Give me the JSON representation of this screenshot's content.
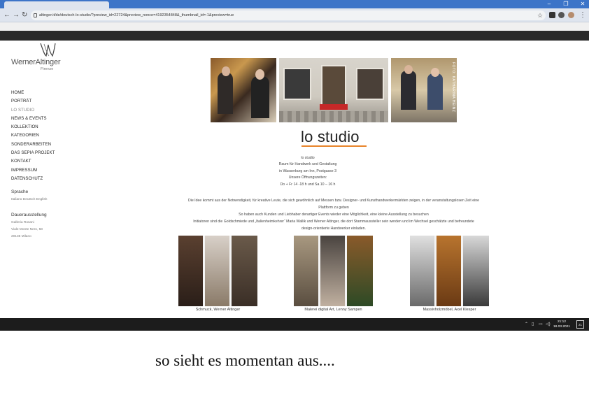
{
  "browser": {
    "url": "altinger.it/de/deutsch-lo-studio/?preview_id=22724&preview_nonce=4192354848&_thumbnail_id=-1&preview=true",
    "win_buttons": [
      "–",
      "❐",
      "✕"
    ]
  },
  "sidebar": {
    "logo_text": "WernerAltinger",
    "logo_sub": "Firenze",
    "nav": [
      "HOME",
      "PORTRÄT",
      "LO STUDIO",
      "NEWS & EVENTS",
      "KOLLEKTION",
      "KATEGORIEN",
      "SONDERARBEITEN",
      "DAS SEPIA PROJEKT",
      "KONTAKT",
      "IMPRESSUM",
      "DATENSCHUTZ"
    ],
    "lang_heading": "Sprache",
    "lang_items": "Italiano Deutsch English",
    "perm_heading": "Dauerausstellung",
    "perm_lines": [
      "Galleria Rosani",
      "Viale Monte Nero, 58",
      "20135 Milano"
    ]
  },
  "main": {
    "photo_credit": "FOTO: KATHARINA HEINZ",
    "title": "lo studio",
    "info_lines": [
      "lo studio",
      "Raum für Handwerk und Gestaltung",
      "in Wasserburg am Inn, Postgasse 3",
      "Unsere Öffnungszeiten:",
      "Do + Fr 14 -18 h und Sa 10 – 16 h"
    ],
    "desc_lines": [
      "Die Idee kommt aus der Notwendigkeit, für kreative Leute, die sich gewöhnlich auf Messen bzw. Designer- und Kunsthandwerkermärkten zeigen, in der veranstaltungslosen Zeit eine",
      "Plattform zu geben",
      "So haben auch Kunden und Liebhaber derartiger Events wieder eine Möglichkeit, eine kleine Ausstellung zu besuchen",
      "Initiatoren sind die Goldschmiede und „Italienheimkehrer“ Maria Wallik und Werner Altinger, die dort Stammaussteller sein werden und im Wechsel geschätzte und befreundete",
      "design-orientierte Handwerker einladen."
    ],
    "captions": [
      "Schmuck, Werner Altinger",
      "Malerei digital Art, Lenny Sampen",
      "Massivholzmöbel, Axel Klesper"
    ]
  },
  "taskbar": {
    "time": "21:12",
    "date": "18.03.2021",
    "notif_count": "21"
  },
  "caption_below": "so sieht es momentan aus...."
}
